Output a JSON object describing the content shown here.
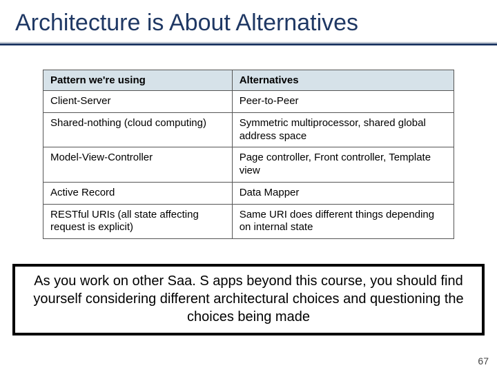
{
  "title": "Architecture is About Alternatives",
  "table": {
    "headers": {
      "col1": "Pattern we're using",
      "col2": "Alternatives"
    },
    "rows": [
      {
        "c1": "Client-Server",
        "c2": "Peer-to-Peer"
      },
      {
        "c1": "Shared-nothing (cloud computing)",
        "c2": "Symmetric multiprocessor, shared global address space"
      },
      {
        "c1": "Model-View-Controller",
        "c2": "Page controller, Front controller, Template view"
      },
      {
        "c1": "Active Record",
        "c2": "Data Mapper"
      },
      {
        "c1": "RESTful URIs (all state affecting request is explicit)",
        "c2": "Same URI does different things depending on internal state"
      }
    ]
  },
  "callout": "As you work on other Saa. S apps beyond this course, you should find yourself considering different architectural choices and questioning the choices being made",
  "page_number": "67"
}
